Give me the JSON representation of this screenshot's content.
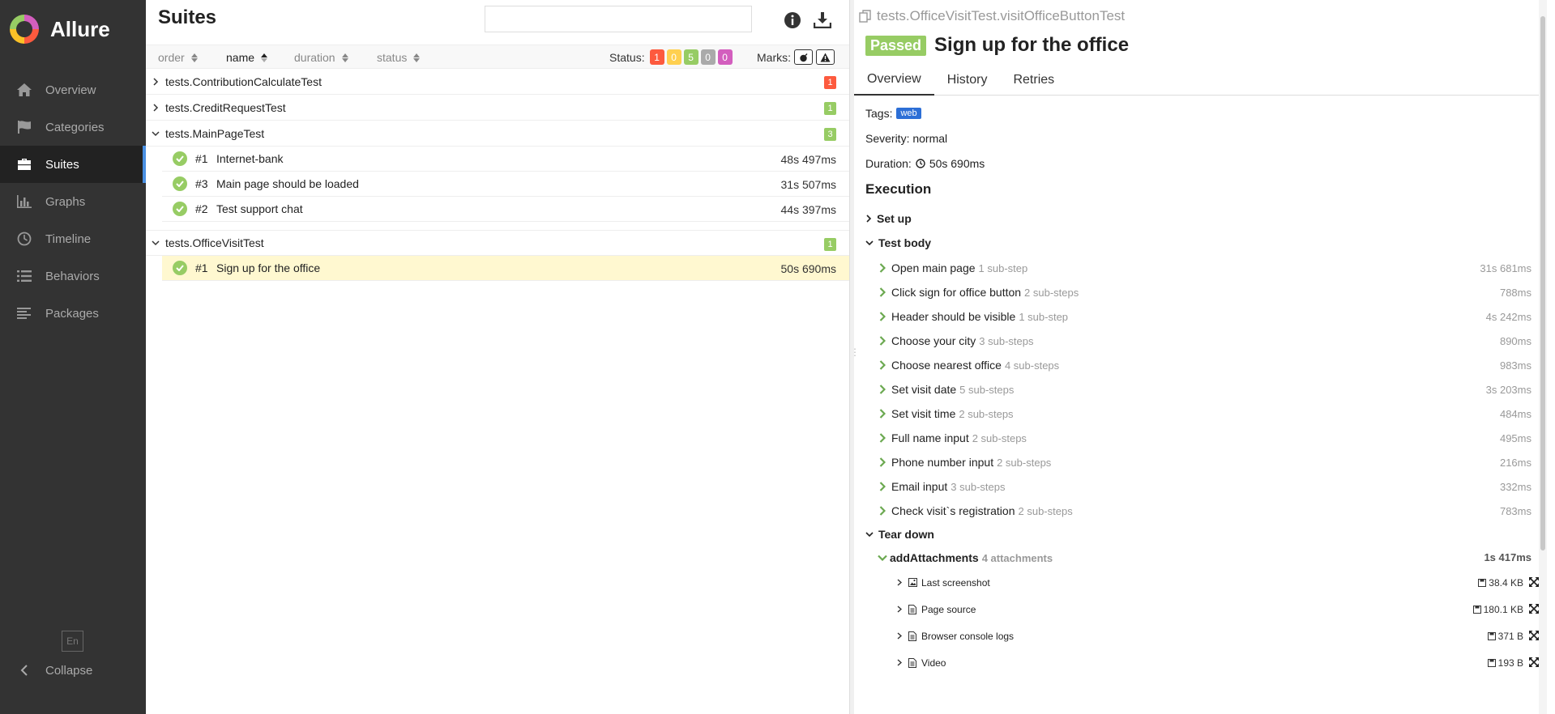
{
  "app": {
    "name": "Allure"
  },
  "sidebar": {
    "items": [
      {
        "label": "Overview",
        "icon": "home-icon",
        "active": false
      },
      {
        "label": "Categories",
        "icon": "flag-icon",
        "active": false
      },
      {
        "label": "Suites",
        "icon": "briefcase-icon",
        "active": true
      },
      {
        "label": "Graphs",
        "icon": "bar-chart-icon",
        "active": false
      },
      {
        "label": "Timeline",
        "icon": "clock-icon",
        "active": false
      },
      {
        "label": "Behaviors",
        "icon": "list-icon",
        "active": false
      },
      {
        "label": "Packages",
        "icon": "align-left-icon",
        "active": false
      }
    ],
    "language": "En",
    "collapse_label": "Collapse"
  },
  "suites": {
    "title": "Suites",
    "search": {
      "value": "",
      "placeholder": ""
    },
    "sort": {
      "order": "order",
      "name": "name",
      "duration": "duration",
      "status": "status"
    },
    "status_label": "Status:",
    "status_counts": [
      {
        "value": "1",
        "color": "#fd5a3e"
      },
      {
        "value": "0",
        "color": "#ffd050"
      },
      {
        "value": "5",
        "color": "#97cc64"
      },
      {
        "value": "0",
        "color": "#aaaaaa"
      },
      {
        "value": "0",
        "color": "#d35ebe"
      }
    ],
    "marks_label": "Marks:",
    "groups": [
      {
        "name": "tests.ContributionCalculateTest",
        "count": "1",
        "count_color": "#fd5a3e",
        "expanded": false
      },
      {
        "name": "tests.CreditRequestTest",
        "count": "1",
        "count_color": "#97cc64",
        "expanded": false
      },
      {
        "name": "tests.MainPageTest",
        "count": "3",
        "count_color": "#97cc64",
        "expanded": true,
        "cases": [
          {
            "num": "#1",
            "title": "Internet-bank",
            "duration": "48s 497ms"
          },
          {
            "num": "#3",
            "title": "Main page should be loaded",
            "duration": "31s 507ms"
          },
          {
            "num": "#2",
            "title": "Test support chat",
            "duration": "44s 397ms"
          }
        ]
      },
      {
        "name": "tests.OfficeVisitTest",
        "count": "1",
        "count_color": "#97cc64",
        "expanded": true,
        "cases": [
          {
            "num": "#1",
            "title": "Sign up for the office",
            "duration": "50s 690ms",
            "selected": true
          }
        ]
      }
    ]
  },
  "details": {
    "full_name": "tests.OfficeVisitTest.visitOfficeButtonTest",
    "status": "Passed",
    "status_color": "#97cc64",
    "title": "Sign up for the office",
    "tabs": [
      "Overview",
      "History",
      "Retries"
    ],
    "tags_label": "Tags:",
    "tag": "web",
    "severity": "Severity: normal",
    "duration_label": "Duration:",
    "duration_value": "50s 690ms",
    "execution_title": "Execution",
    "setup_label": "Set up",
    "test_body_label": "Test body",
    "steps": [
      {
        "name": "Open main page",
        "sub": "1 sub-step",
        "duration": "31s 681ms"
      },
      {
        "name": "Click sign for office button",
        "sub": "2 sub-steps",
        "duration": "788ms"
      },
      {
        "name": "Header should be visible",
        "sub": "1 sub-step",
        "duration": "4s 242ms"
      },
      {
        "name": "Choose your city",
        "sub": "3 sub-steps",
        "duration": "890ms"
      },
      {
        "name": "Choose nearest office",
        "sub": "4 sub-steps",
        "duration": "983ms"
      },
      {
        "name": "Set visit date",
        "sub": "5 sub-steps",
        "duration": "3s 203ms"
      },
      {
        "name": "Set visit time",
        "sub": "2 sub-steps",
        "duration": "484ms"
      },
      {
        "name": "Full name input",
        "sub": "2 sub-steps",
        "duration": "495ms"
      },
      {
        "name": "Phone number input",
        "sub": "2 sub-steps",
        "duration": "216ms"
      },
      {
        "name": "Email input",
        "sub": "3 sub-steps",
        "duration": "332ms"
      },
      {
        "name": "Check visit`s registration",
        "sub": "2 sub-steps",
        "duration": "783ms"
      }
    ],
    "teardown_label": "Tear down",
    "teardown_step": {
      "name": "addAttachments",
      "sub": "4 attachments",
      "duration": "1s 417ms"
    },
    "attachments": [
      {
        "name": "Last screenshot",
        "icon": "image-file-icon",
        "size": "38.4 KB"
      },
      {
        "name": "Page source",
        "icon": "text-file-icon",
        "size": "180.1 KB"
      },
      {
        "name": "Browser console logs",
        "icon": "text-file-icon",
        "size": "371 B"
      },
      {
        "name": "Video",
        "icon": "text-file-icon",
        "size": "193 B"
      }
    ]
  }
}
